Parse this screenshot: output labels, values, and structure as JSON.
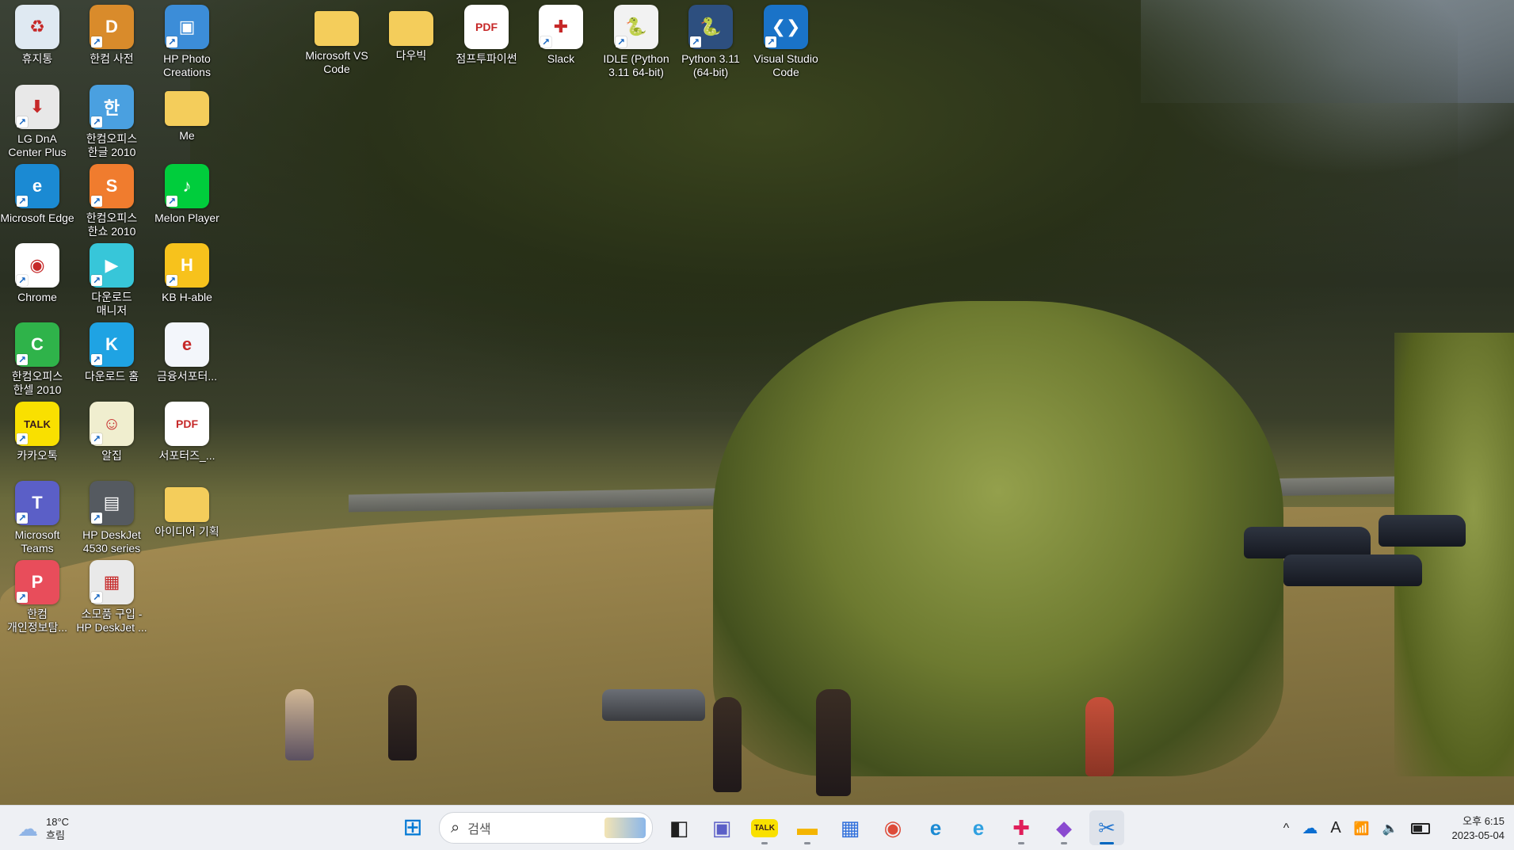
{
  "desktop": {
    "icons": [
      {
        "label": "휴지통",
        "icon": "recycle-bin-icon",
        "color": "#dfe9f2",
        "glyph": "♻"
      },
      {
        "label": "한컴 사전",
        "icon": "hancom-dictionary-icon",
        "color": "#d98b2b",
        "glyph": "D"
      },
      {
        "label": "HP Photo Creations",
        "icon": "hp-photo-creations-icon",
        "color": "#3c8dd8",
        "glyph": "▣"
      },
      {
        "label": "Microsoft VS Code",
        "icon": "folder-icon",
        "color": "#f4cd5b",
        "glyph": ""
      },
      {
        "label": "다우빅",
        "icon": "folder-icon",
        "color": "#f4cd5b",
        "glyph": ""
      },
      {
        "label": "점프투파이썬",
        "icon": "pdf-file-icon",
        "color": "#ffffff",
        "glyph": "PDF"
      },
      {
        "label": "Slack",
        "icon": "slack-icon",
        "color": "#ffffff",
        "glyph": "✚"
      },
      {
        "label": "IDLE (Python 3.11 64-bit)",
        "icon": "python-idle-icon",
        "color": "#f2f2f2",
        "glyph": "🐍"
      },
      {
        "label": "Python 3.11 (64-bit)",
        "icon": "python-icon",
        "color": "#2d4f7f",
        "glyph": "🐍"
      },
      {
        "label": "Visual Studio Code",
        "icon": "vscode-icon",
        "color": "#1a73c8",
        "glyph": "❮❯"
      },
      {
        "label": "LG DnA Center Plus",
        "icon": "lg-dna-center-icon",
        "color": "#e8e8e8",
        "glyph": "⬇"
      },
      {
        "label": "한컴오피스 한글 2010",
        "icon": "hancom-hangul-icon",
        "color": "#4aa0e0",
        "glyph": "한"
      },
      {
        "label": "Me",
        "icon": "folder-icon",
        "color": "#f4cd5b",
        "glyph": ""
      },
      {
        "label": "Microsoft Edge",
        "icon": "edge-icon",
        "color": "#1b8ad3",
        "glyph": "e"
      },
      {
        "label": "한컴오피스 한쇼 2010",
        "icon": "hancom-show-icon",
        "color": "#f07c2e",
        "glyph": "S"
      },
      {
        "label": "Melon Player",
        "icon": "melon-player-icon",
        "color": "#00cd3c",
        "glyph": "♪"
      },
      {
        "label": "Chrome",
        "icon": "chrome-icon",
        "color": "#ffffff",
        "glyph": "◉"
      },
      {
        "label": "다운로드 매니저",
        "icon": "download-manager-icon",
        "color": "#37c6d9",
        "glyph": "▶"
      },
      {
        "label": "KB H-able",
        "icon": "kb-h-able-icon",
        "color": "#f7c21c",
        "glyph": "H"
      },
      {
        "label": "한컴오피스 한셀 2010",
        "icon": "hancom-cell-icon",
        "color": "#2fb34a",
        "glyph": "C"
      },
      {
        "label": "다운로드 홈",
        "icon": "download-home-icon",
        "color": "#1fa3e3",
        "glyph": "K"
      },
      {
        "label": "금융서포터...",
        "icon": "financial-supporter-icon",
        "color": "#f3f6fb",
        "glyph": "e"
      },
      {
        "label": "카카오톡",
        "icon": "kakaotalk-icon",
        "color": "#f9e000",
        "glyph": "TALK"
      },
      {
        "label": "알집",
        "icon": "alzip-icon",
        "color": "#f0eecf",
        "glyph": "☺"
      },
      {
        "label": "서포터즈_...",
        "icon": "pdf-file-icon",
        "color": "#ffffff",
        "glyph": "PDF"
      },
      {
        "label": "Microsoft Teams",
        "icon": "teams-icon",
        "color": "#5b5fc7",
        "glyph": "T"
      },
      {
        "label": "HP DeskJet 4530 series",
        "icon": "printer-icon",
        "color": "#555a60",
        "glyph": "▤"
      },
      {
        "label": "아이디어 기획",
        "icon": "folder-icon",
        "color": "#f4cd5b",
        "glyph": ""
      },
      {
        "label": "한컴 개인정보탐...",
        "icon": "hancom-privacy-icon",
        "color": "#e84d5b",
        "glyph": "P"
      },
      {
        "label": "소모품 구입 - HP DeskJet ...",
        "icon": "hp-supplies-icon",
        "color": "#e9e9e9",
        "glyph": "▦"
      }
    ]
  },
  "taskbar": {
    "weather": {
      "temp": "18°C",
      "condition": "흐림"
    },
    "search": {
      "placeholder": "검색"
    },
    "apps": [
      {
        "name": "start-button",
        "icon": "windows-start-icon",
        "glyph": "⊞",
        "color": "#0078d4"
      },
      {
        "name": "search-box",
        "icon": "search-icon"
      },
      {
        "name": "task-view-button",
        "icon": "task-view-icon",
        "glyph": "◧",
        "color": "#1f1f1f"
      },
      {
        "name": "teams-chat-button",
        "icon": "teams-chat-icon",
        "glyph": "▣",
        "color": "#5b5fc7"
      },
      {
        "name": "kakaotalk-taskbar-button",
        "icon": "kakaotalk-icon",
        "glyph": "TALK",
        "color": "#f9e000"
      },
      {
        "name": "file-explorer-button",
        "icon": "file-explorer-icon",
        "glyph": "▬",
        "color": "#f4b400"
      },
      {
        "name": "microsoft-store-button",
        "icon": "store-icon",
        "glyph": "▦",
        "color": "#2f6fdb"
      },
      {
        "name": "chrome-taskbar-button",
        "icon": "chrome-icon",
        "glyph": "◉",
        "color": "#dd4b39"
      },
      {
        "name": "edge-taskbar-button",
        "icon": "edge-icon",
        "glyph": "e",
        "color": "#1b8ad3"
      },
      {
        "name": "internet-explorer-button",
        "icon": "internet-explorer-icon",
        "glyph": "e",
        "color": "#2fa0e0"
      },
      {
        "name": "slack-taskbar-button",
        "icon": "slack-icon",
        "glyph": "✚",
        "color": "#e01e5a"
      },
      {
        "name": "visual-studio-button",
        "icon": "visual-studio-icon",
        "glyph": "◆",
        "color": "#8a4ad0"
      },
      {
        "name": "snipping-tool-button",
        "icon": "snipping-tool-icon",
        "glyph": "✂",
        "color": "#2878d0"
      }
    ],
    "tray": {
      "chevron": "^",
      "input_indicator": "A",
      "time": "오후 6:15",
      "date": "2023-05-04"
    }
  }
}
